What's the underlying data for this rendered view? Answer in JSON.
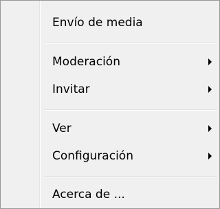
{
  "menu": {
    "items": [
      {
        "label": "Envío de media",
        "has_submenu": false
      },
      {
        "label": "Moderación",
        "has_submenu": true
      },
      {
        "label": "Invitar",
        "has_submenu": true
      },
      {
        "label": "Ver",
        "has_submenu": true
      },
      {
        "label": "Configuración",
        "has_submenu": true
      },
      {
        "label": "Acerca de ...",
        "has_submenu": false
      }
    ],
    "colors": {
      "background": "#f0f0f0",
      "border": "#979797",
      "text": "#000000",
      "separator": "#e0e0e0"
    }
  }
}
